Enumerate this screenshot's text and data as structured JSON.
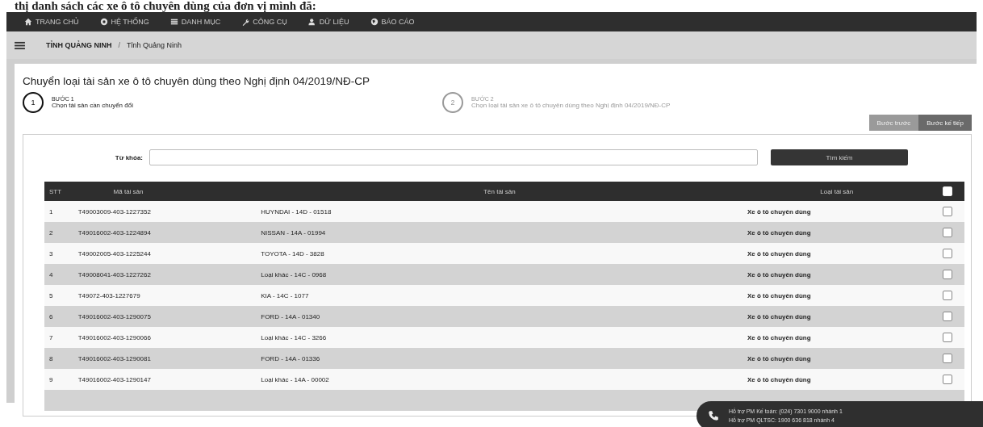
{
  "caption": "thị danh sách các xe ô tô chuyên dùng của đơn vị mình đã:",
  "nav": [
    {
      "label": "TRANG CHỦ",
      "kind": "home"
    },
    {
      "label": "HỆ THỐNG",
      "kind": "gear"
    },
    {
      "label": "DANH MỤC",
      "kind": "grid"
    },
    {
      "label": "CÔNG CỤ",
      "kind": "wrench"
    },
    {
      "label": "DỮ LIỆU",
      "kind": "user"
    },
    {
      "label": "BÁO CÁO",
      "kind": "chart"
    }
  ],
  "breadcrumb": {
    "root": "TỈNH QUẢNG NINH",
    "separator": "/",
    "current": "Tỉnh Quảng Ninh"
  },
  "title": "Chuyển loại tài sản xe ô tô chuyên dùng theo Nghị định 04/2019/NĐ-CP",
  "steps": [
    {
      "number": "1",
      "label": "BƯỚC 1",
      "text": "Chọn tài sản cần chuyển đổi",
      "selected": true
    },
    {
      "number": "2",
      "label": "BƯỚC 2",
      "text": "Chọn loại tài sản xe ô tô chuyên dùng theo Nghị định 04/2019/NĐ-CP",
      "selected": false
    }
  ],
  "step_buttons": [
    "Bước trước",
    "Bước kế tiếp"
  ],
  "search": {
    "label": "Từ khóa:",
    "button": "Tìm kiếm"
  },
  "table": {
    "columns": [
      "STT",
      "Mã tài sản",
      "Tên tài sản",
      "Loại tài sản"
    ],
    "all_checked": false,
    "rows": [
      {
        "stt": "1",
        "code": "T49003009-403-1227352",
        "name": "HUYNDAI - 14D - 01518",
        "type": "Xe ô tô chuyên dùng",
        "checked": false
      },
      {
        "stt": "2",
        "code": "T49016002-403-1224894",
        "name": "NISSAN - 14A - 01994",
        "type": "Xe ô tô chuyên dùng",
        "checked": false
      },
      {
        "stt": "3",
        "code": "T49002005-403-1225244",
        "name": "TOYOTA - 14D - 3828",
        "type": "Xe ô tô chuyên dùng",
        "checked": false
      },
      {
        "stt": "4",
        "code": "T49008041-403-1227262",
        "name": "Loại khác - 14C - 0968",
        "type": "Xe ô tô chuyên dùng",
        "checked": false
      },
      {
        "stt": "5",
        "code": "T49072-403-1227679",
        "name": "KIA - 14C - 1077",
        "type": "Xe ô tô chuyên dùng",
        "checked": false
      },
      {
        "stt": "6",
        "code": "T49016002-403-1290075",
        "name": "FORD - 14A - 01340",
        "type": "Xe ô tô chuyên dùng",
        "checked": false
      },
      {
        "stt": "7",
        "code": "T49016002-403-1290066",
        "name": "Loại khác - 14C - 3266",
        "type": "Xe ô tô chuyên dùng",
        "checked": false
      },
      {
        "stt": "8",
        "code": "T49016002-403-1290081",
        "name": "FORD - 14A - 01336",
        "type": "Xe ô tô chuyên dùng",
        "checked": false
      },
      {
        "stt": "9",
        "code": "T49016002-403-1290147",
        "name": "Loại khác - 14A - 00002",
        "type": "Xe ô tô chuyên dùng",
        "checked": false
      }
    ]
  },
  "support": [
    "Hỗ trợ PM Kế toán: (024) 7301 9000 nhánh 1",
    "Hỗ trợ PM QLTSC: 1900 636 818 nhánh 4"
  ]
}
